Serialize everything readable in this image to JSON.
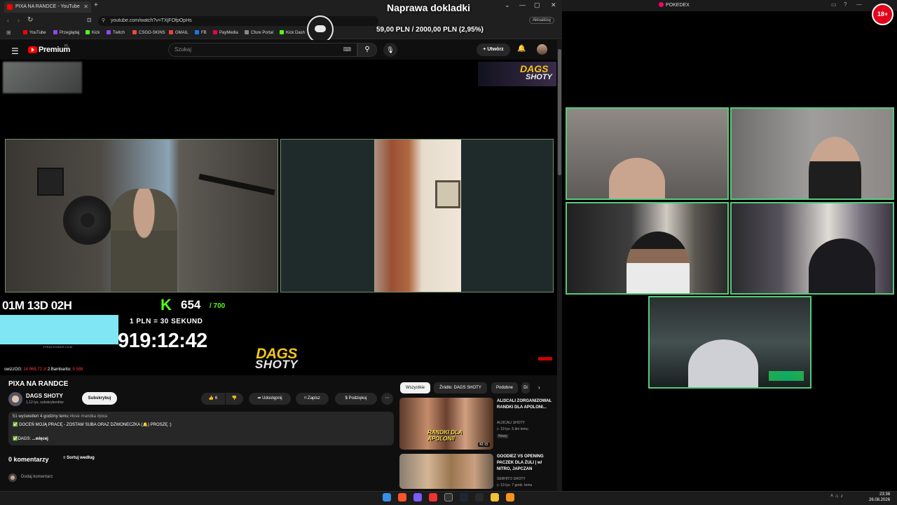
{
  "browser": {
    "tab_title": "PIXA NA RANDCE - YouTube",
    "url": "youtube.com/watch?v=TXjFOfpOpHs",
    "update_label": "Aktualizuj",
    "bookmarks": [
      {
        "label": "YouTube",
        "color": "#ff0000"
      },
      {
        "label": "Przeglądaj",
        "color": "#9146ff"
      },
      {
        "label": "Kick",
        "color": "#53fc18"
      },
      {
        "label": "Twitch",
        "color": "#9146ff"
      },
      {
        "label": "CSGO-SKINS",
        "color": "#e94b3c"
      },
      {
        "label": "GMAIL",
        "color": "#ea4335"
      },
      {
        "label": "FB",
        "color": "#1877f2"
      },
      {
        "label": "PayMedia",
        "color": "#e5005b"
      },
      {
        "label": "Cfure Portal",
        "color": "#888888"
      },
      {
        "label": "Kick Dash",
        "color": "#53fc18"
      }
    ]
  },
  "overlay": {
    "title": "Naprawa dokladki",
    "goal": "59,00 PLN / 2000,00 PLN (2,95%)"
  },
  "youtube": {
    "brand": "Premium",
    "brand_region": "PL",
    "search_placeholder": "Szukaj",
    "create_label": "Utwórz"
  },
  "stream": {
    "countdown": "01M 13D 02H",
    "k_icon": "K",
    "kick_count": "654",
    "kick_goal": "/ 700",
    "rate": "1 PLN = 30 SEKUND",
    "big_timer": "919:12:42",
    "logo_line1": "DAGS",
    "logo_line2": "SHOTY",
    "pirates": "PIRATESWAP.COM",
    "ticker_names": "swizzOG:",
    "ticker_value1": "14 968,72 zł",
    "ticker_name2": "2.Bambarito:",
    "ticker_value2": "9 588"
  },
  "video": {
    "title": "PIXA NA RANDCE",
    "channel": "DAGS SHOTY",
    "subs": "1,12 tys. subskrybentów",
    "subscribe": "Subskrybuj",
    "likes": "6",
    "share": "Udostępnij",
    "save": "Zapisz",
    "thanks": "Podziękuj",
    "views_meta": "51 wyświetleń  4 godziny temu",
    "tags": "#love #randka #pixa",
    "desc_line1": "✅ DOCEŃ MOJĄ PRACĘ - ZOSTAW SUBA ORAZ DZWONECZKA (🔔) PROSZĘ :)",
    "desc_line2": "✅DAGS:",
    "desc_more": "...więcej",
    "comments": "0 komentarzy",
    "sort": "Sortuj według",
    "add_comment": "Dodaj komentarz"
  },
  "related": {
    "chips": [
      "Wszystkie",
      "Źródło: DAGS SHOTY",
      "Podobne",
      "Di"
    ],
    "items": [
      {
        "title": "ALI3CALI ZORGANIZOWAŁ RANDKI DLA APOLONI...",
        "channel": "ALI3CALI SHOTY",
        "meta": "▷ 19 tys.  5 dni temu",
        "badge": "Nowy",
        "duration": "42:15",
        "thumb_text": "RANDKI DLA APOLONII"
      },
      {
        "title": "GOODIEZ VS OPENING PACZEK DLA ŻULI | w/ NITRO, JAPCZAN",
        "channel": "SERHITO SHOTY",
        "meta": "▷ 13 tys.  7 godz. temu"
      }
    ]
  },
  "right": {
    "window_title": "POKEDEX",
    "badge": "18+"
  },
  "taskbar": {
    "time": "23:38",
    "date": "26.08.2026"
  }
}
